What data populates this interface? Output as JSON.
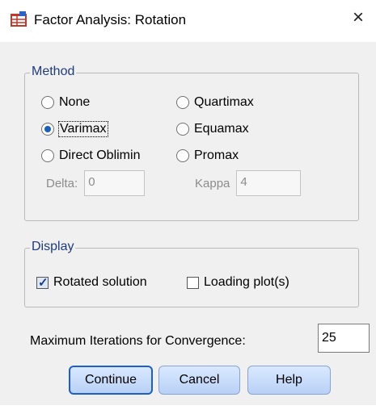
{
  "window": {
    "title": "Factor Analysis: Rotation",
    "close_glyph": "×",
    "icon": "spss-table-icon"
  },
  "method": {
    "legend": "Method",
    "options": [
      {
        "label": "None",
        "selected": false
      },
      {
        "label": "Quartimax",
        "selected": false
      },
      {
        "label": "Varimax",
        "selected": true
      },
      {
        "label": "Equamax",
        "selected": false
      },
      {
        "label": "Direct Oblimin",
        "selected": false
      },
      {
        "label": "Promax",
        "selected": false
      }
    ],
    "delta": {
      "label": "Delta:",
      "value": "0"
    },
    "kappa": {
      "label": "Kappa",
      "value": "4"
    }
  },
  "display": {
    "legend": "Display",
    "rotated_solution": {
      "label": "Rotated solution",
      "checked": true
    },
    "loading_plots": {
      "label": "Loading plot(s)",
      "checked": false
    }
  },
  "iterations": {
    "label": "Maximum Iterations for Convergence:",
    "value": "25"
  },
  "buttons": {
    "continue": "Continue",
    "cancel": "Cancel",
    "help": "Help"
  }
}
